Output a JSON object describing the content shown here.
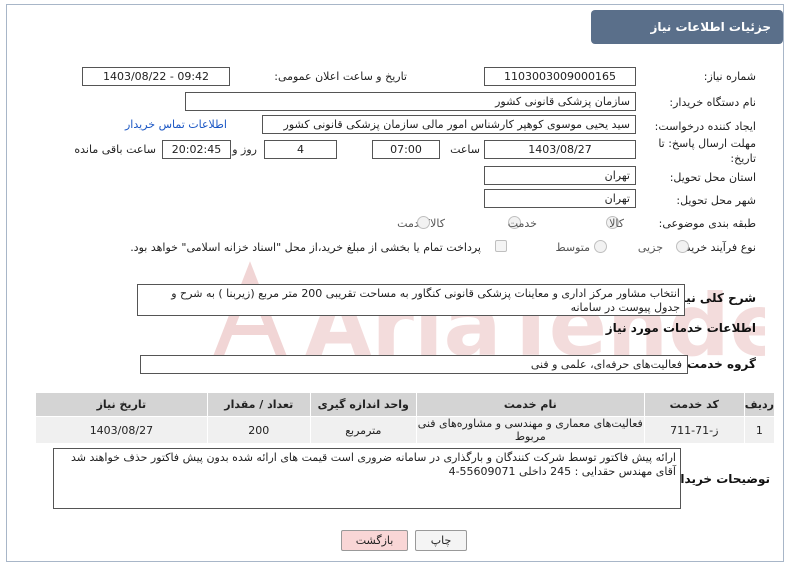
{
  "header": {
    "title": "جزئیات اطلاعات نیاز"
  },
  "need_number": {
    "label": "شماره نیاز:",
    "value": "1103003009000165"
  },
  "announce_datetime": {
    "label": "تاریخ و ساعت اعلان عمومی:",
    "value": "1403/08/22 - 09:42"
  },
  "buyer_org": {
    "label": "نام دستگاه خریدار:",
    "value": "سازمان پزشکی قانونی کشور"
  },
  "requester": {
    "label": "ایجاد کننده درخواست:",
    "value": "سید یحیی موسوی کوهپر کارشناس امور مالی سازمان پزشکی قانونی کشور",
    "contact_link": "اطلاعات تماس خریدار"
  },
  "deadline": {
    "label_line1": "مهلت ارسال پاسخ: تا",
    "label_line2": "تاریخ:",
    "date": "1403/08/27",
    "time_label": "ساعت",
    "time": "07:00",
    "days": "4",
    "days_label": "روز و",
    "remaining": "20:02:45",
    "remaining_label": "ساعت باقی مانده"
  },
  "delivery_province": {
    "label": "استان محل تحویل:",
    "value": "تهران"
  },
  "delivery_city": {
    "label": "شهر محل تحویل:",
    "value": "تهران"
  },
  "category": {
    "label": "طبقه بندی موضوعی:",
    "options": [
      "کالا",
      "خدمت",
      "کالا/خدمت"
    ]
  },
  "process_type": {
    "label": "نوع فرآیند خرید :",
    "options": [
      "جزیی",
      "متوسط"
    ],
    "payment_note": "پرداخت تمام یا بخشی از مبلغ خرید،از محل \"اسناد خزانه اسلامی\" خواهد بود."
  },
  "general_description": {
    "label": "شرح کلی نیاز:",
    "value": "انتخاب مشاور مرکز اداری و معاینات پزشکی قانونی کنگاور به مساحت تقریبی 200 متر مربع (زیربنا )  به شرح و جدول پیوست در سامانه"
  },
  "services_section": {
    "title": "اطلاعات خدمات مورد نیاز"
  },
  "service_group": {
    "label": "گروه خدمت:",
    "value": "فعالیت‌های حرفه‌ای، علمی و فنی"
  },
  "services_table": {
    "headers": [
      "ردیف",
      "کد خدمت",
      "نام خدمت",
      "واحد اندازه گیری",
      "تعداد / مقدار",
      "تاریخ نیاز"
    ],
    "rows": [
      [
        "1",
        "ز-71-711",
        "فعالیت‌های معماری و مهندسی و مشاوره‌های فنی مربوط",
        "مترمربع",
        "200",
        "1403/08/27"
      ]
    ]
  },
  "buyer_notes": {
    "label": "توضیحات خریدار:",
    "line1": "ارائه پیش فاکتور توسط شرکت کنندگان و بارگذاری در سامانه ضروری است قیمت های ارائه شده بدون پیش فاکتور حذف خواهند شد",
    "line2": "آقای مهندس حقدایی :   245   داخلی        55609071-4"
  },
  "buttons": {
    "print": "چاپ",
    "back": "بازگشت"
  },
  "watermark_text": "AriaTender.net",
  "colors": {
    "header_bg": "#5a6f8a",
    "link": "#1a56c4",
    "back_button_bg": "#f9d6d6",
    "watermark": "#e6b3b3"
  }
}
